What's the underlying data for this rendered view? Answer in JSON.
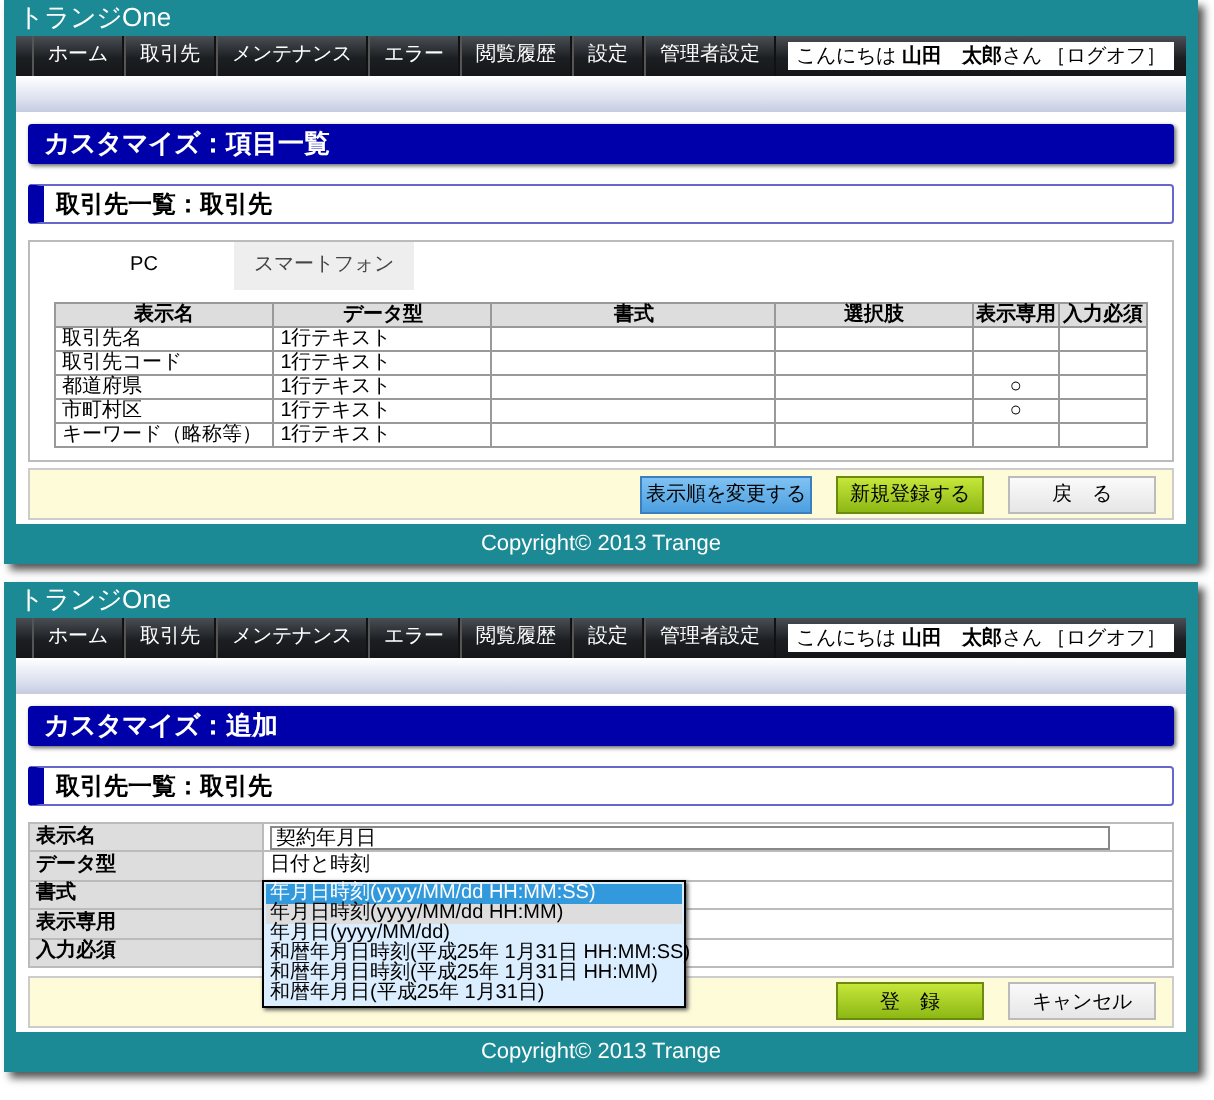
{
  "windows": [
    {
      "app_title": "トランジOne",
      "nav": [
        "ホーム",
        "取引先",
        "メンテナンス",
        "エラー",
        "閲覧履歴",
        "設定",
        "管理者設定"
      ],
      "greeting": "こんにちは **山田　太郎**さん",
      "logoff": "［ログオフ］",
      "page_title": "カスタマイズ：項目一覧",
      "section_title": "取引先一覧：取引先",
      "kind": "list",
      "tabs": [
        {
          "label": "PC",
          "selected": true
        },
        {
          "label": "スマートフォン",
          "selected": false
        }
      ],
      "table": {
        "columns": [
          "表示名",
          "データ型",
          "書式",
          "選択肢",
          "表示専用",
          "入力必須"
        ],
        "rows": [
          {
            "display_name": "取引先名",
            "data_type": "1行テキスト"
          },
          {
            "display_name": "取引先コード",
            "data_type": "1行テキスト"
          },
          {
            "display_name": "都道府県",
            "data_type": "1行テキスト",
            "display_only": "○"
          },
          {
            "display_name": "市町村区",
            "data_type": "1行テキスト",
            "display_only": "○"
          },
          {
            "display_name": "キーワード（略称等）",
            "data_type": "1行テキスト"
          }
        ]
      },
      "buttons": [
        {
          "label": "表示順を変更する",
          "kind": "secondary"
        },
        {
          "label": "新規登録する",
          "kind": "primary"
        },
        {
          "label": "戻　る",
          "kind": "plain"
        }
      ],
      "copyright": "Copyright© 2013 Trange"
    },
    {
      "app_title": "トランジOne",
      "nav": [
        "ホーム",
        "取引先",
        "メンテナンス",
        "エラー",
        "閲覧履歴",
        "設定",
        "管理者設定"
      ],
      "greeting": "こんにちは **山田　太郎**さん",
      "logoff": "［ログオフ］",
      "page_title": "カスタマイズ：追加",
      "section_title": "取引先一覧：取引先",
      "kind": "form",
      "form": [
        {
          "label": "表示名",
          "kind": "input",
          "value": "契約年月日"
        },
        {
          "label": "データ型",
          "kind": "text",
          "value": "日付と時刻"
        },
        {
          "label": "書式",
          "kind": "select"
        },
        {
          "label": "表示専用",
          "kind": "none"
        },
        {
          "label": "入力必須",
          "kind": "none"
        }
      ],
      "dropdown": [
        {
          "label": "年月日時刻(yyyy/MM/dd HH:MM:SS)",
          "selected": true,
          "hovered": false
        },
        {
          "label": "年月日時刻(yyyy/MM/dd HH:MM)",
          "selected": false,
          "hovered": true
        },
        {
          "label": "年月日(yyyy/MM/dd)",
          "selected": false,
          "hovered": false
        },
        {
          "label": "和暦年月日時刻(平成25年 1月31日 HH:MM:SS)",
          "selected": false,
          "hovered": false
        },
        {
          "label": "和暦年月日時刻(平成25年 1月31日 HH:MM)",
          "selected": false,
          "hovered": false
        },
        {
          "label": "和暦年月日(平成25年 1月31日)",
          "selected": false,
          "hovered": false
        }
      ],
      "buttons": [
        {
          "label": "登　録",
          "kind": "primary"
        },
        {
          "label": "キャンセル",
          "kind": "plain"
        }
      ],
      "copyright": "Copyright© 2013 Trange"
    }
  ]
}
